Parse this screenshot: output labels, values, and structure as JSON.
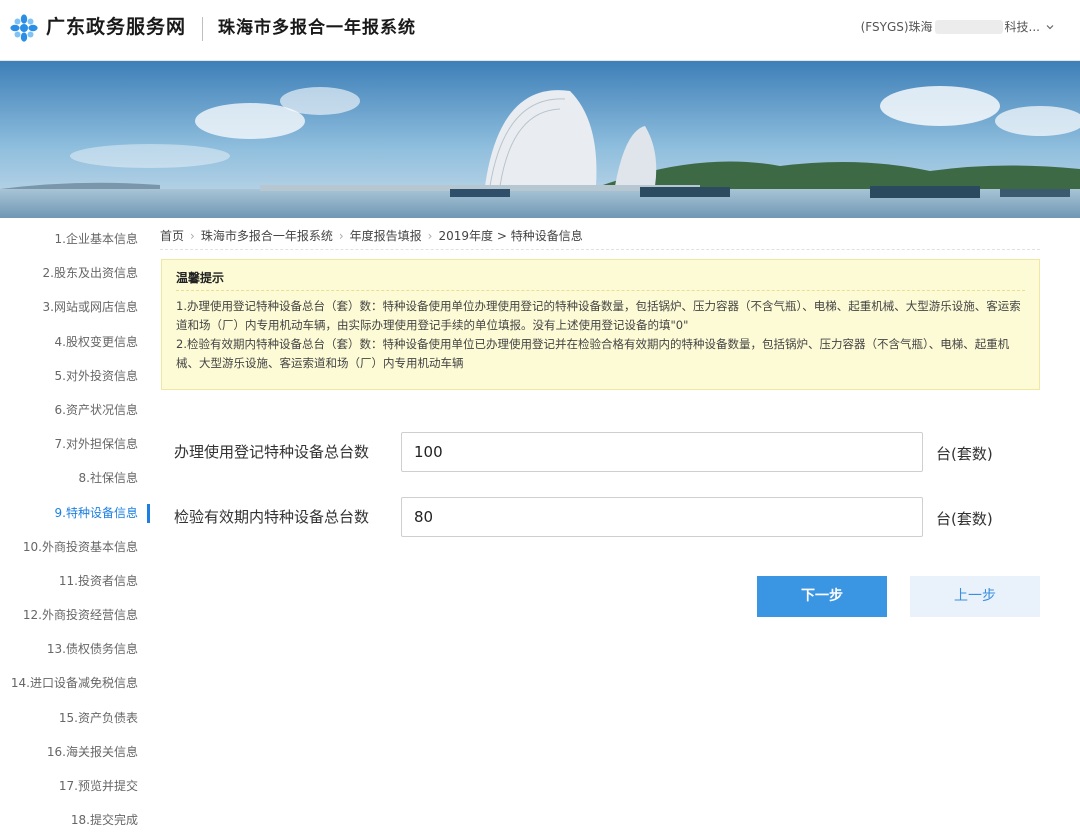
{
  "header": {
    "brand": "广东政务服务网",
    "system_title": "珠海市多报合一年报系统",
    "user_prefix": "(FSYGS)珠海",
    "user_suffix": "科技..."
  },
  "sidebar": {
    "items": [
      {
        "label": "1.企业基本信息"
      },
      {
        "label": "2.股东及出资信息"
      },
      {
        "label": "3.网站或网店信息"
      },
      {
        "label": "4.股权变更信息"
      },
      {
        "label": "5.对外投资信息"
      },
      {
        "label": "6.资产状况信息"
      },
      {
        "label": "7.对外担保信息"
      },
      {
        "label": "8.社保信息"
      },
      {
        "label": "9.特种设备信息"
      },
      {
        "label": "10.外商投资基本信息"
      },
      {
        "label": "11.投资者信息"
      },
      {
        "label": "12.外商投资经营信息"
      },
      {
        "label": "13.债权债务信息"
      },
      {
        "label": "14.进口设备减免税信息"
      },
      {
        "label": "15.资产负债表"
      },
      {
        "label": "16.海关报关信息"
      },
      {
        "label": "17.预览并提交"
      },
      {
        "label": "18.提交完成"
      }
    ],
    "active_index": 8
  },
  "breadcrumb": {
    "home": "首页",
    "system": "珠海市多报合一年报系统",
    "section": "年度报告填报",
    "current": "2019年度 > 特种设备信息"
  },
  "notice": {
    "title": "温馨提示",
    "line1": "1.办理使用登记特种设备总台（套）数：特种设备使用单位办理使用登记的特种设备数量，包括锅炉、压力容器（不含气瓶）、电梯、起重机械、大型游乐设施、客运索道和场（厂）内专用机动车辆，由实际办理使用登记手续的单位填报。没有上述使用登记设备的填\"0\"",
    "line2": "2.检验有效期内特种设备总台（套）数：特种设备使用单位已办理使用登记并在检验合格有效期内的特种设备数量，包括锅炉、压力容器（不含气瓶）、电梯、起重机械、大型游乐设施、客运索道和场（厂）内专用机动车辆"
  },
  "form": {
    "registered": {
      "label": "办理使用登记特种设备总台数",
      "value": "100",
      "unit": "台(套数)"
    },
    "inspected": {
      "label": "检验有效期内特种设备总台数",
      "value": "80",
      "unit": "台(套数)"
    }
  },
  "buttons": {
    "next": "下一步",
    "prev": "上一步"
  },
  "colors": {
    "accent": "#1e7fe0",
    "primary_button": "#3a95e3",
    "notice_bg": "#fdfbd6"
  }
}
